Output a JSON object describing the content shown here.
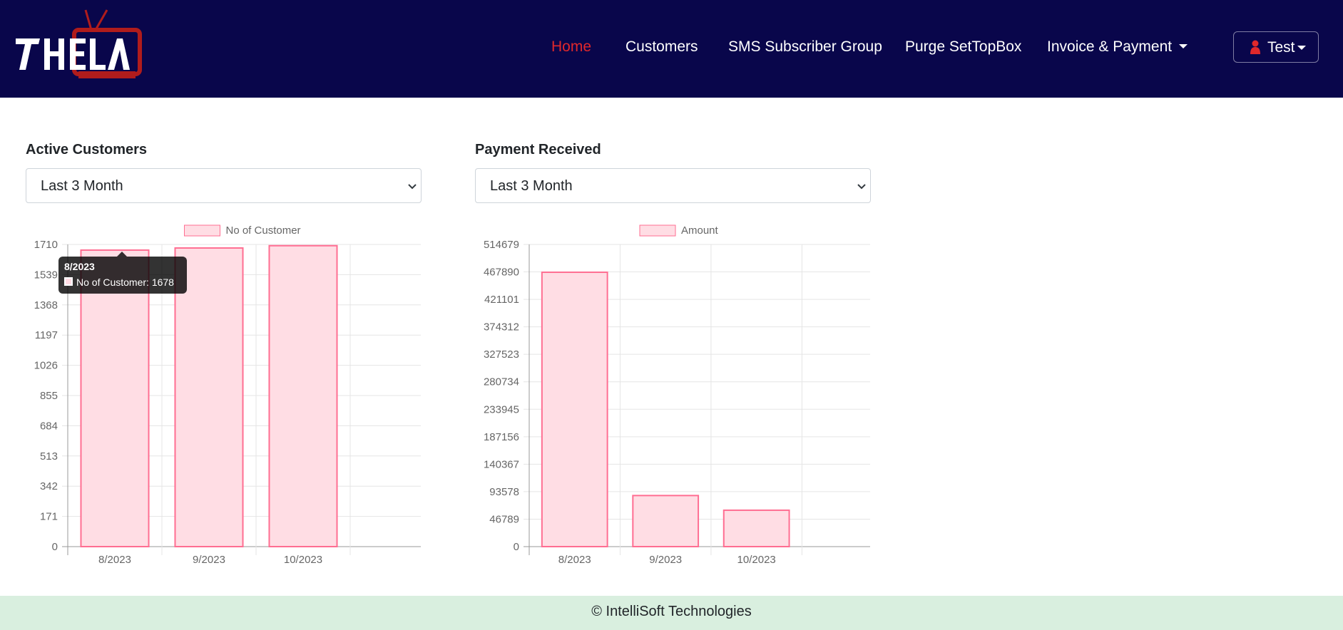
{
  "header": {
    "logo_text": "TAHELA",
    "nav": [
      {
        "label": "Home",
        "active": true
      },
      {
        "label": "Customers"
      },
      {
        "label": "SMS Subscriber Group"
      },
      {
        "label": "Purge SetTopBox"
      },
      {
        "label": "Invoice & Payment",
        "dropdown": true
      }
    ],
    "user": {
      "label": "Test",
      "icon": "user-icon"
    }
  },
  "colors": {
    "navbar": "#09064b",
    "active_nav": "#e0282b",
    "bar_fill": "#ffdde4",
    "bar_border": "#ff6e92",
    "footer": "#d9efdf"
  },
  "panels": [
    {
      "title": "Active Customers",
      "select": {
        "value": "Last 3 Month"
      }
    },
    {
      "title": "Payment Received",
      "select": {
        "value": "Last 3 Month"
      }
    }
  ],
  "chart_data": [
    {
      "type": "bar",
      "categories": [
        "8/2023",
        "9/2023",
        "10/2023"
      ],
      "series": [
        {
          "name": "No of Customer",
          "values": [
            1678,
            1690,
            1703
          ]
        }
      ],
      "yticks": [
        "0",
        "171",
        "342",
        "513",
        "684",
        "855",
        "1026",
        "1197",
        "1368",
        "1539",
        "1710"
      ],
      "ylim": [
        0,
        1710
      ],
      "legend": "top",
      "grid": true
    },
    {
      "type": "bar",
      "categories": [
        "8/2023",
        "9/2023",
        "10/2023"
      ],
      "series": [
        {
          "name": "Amount",
          "values": [
            467300,
            87000,
            62000
          ]
        }
      ],
      "yticks": [
        "0",
        "46789",
        "93578",
        "140367",
        "187156",
        "233945",
        "280734",
        "327523",
        "374312",
        "421101",
        "467890",
        "514679"
      ],
      "ylim": [
        0,
        514679
      ],
      "legend": "top",
      "grid": true
    }
  ],
  "tooltip": {
    "title": "8/2023",
    "body": "No of Customer: 1678"
  },
  "footer": {
    "text": "© IntelliSoft Technologies"
  }
}
